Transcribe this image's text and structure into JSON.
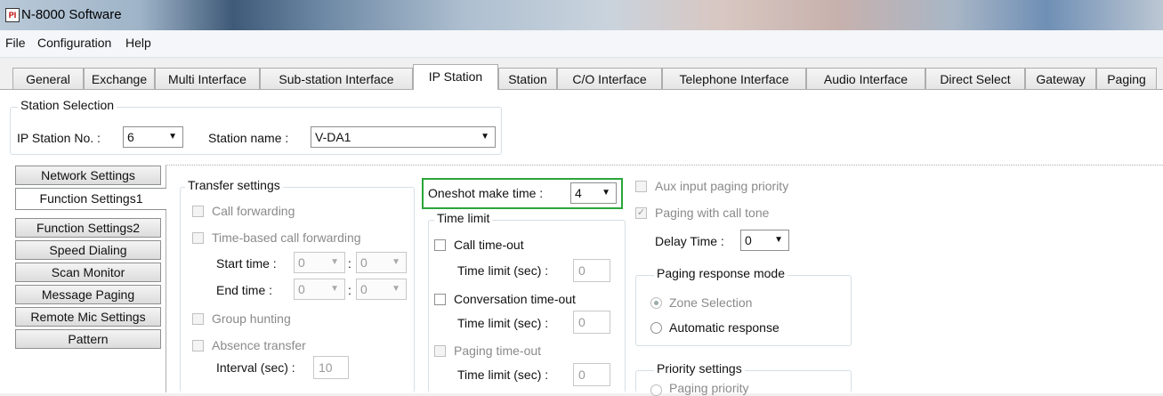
{
  "window": {
    "title": "N-8000 Software",
    "icon_text": "PI"
  },
  "menu": [
    "File",
    "Configuration",
    "Help"
  ],
  "tabs": [
    "General",
    "Exchange",
    "Multi Interface",
    "Sub-station Interface",
    "IP Station",
    "Station",
    "C/O Interface",
    "Telephone Interface",
    "Audio Interface",
    "Direct Select",
    "Gateway",
    "Paging"
  ],
  "active_tab": "IP Station",
  "station_selection": {
    "legend": "Station Selection",
    "ip_no_label": "IP Station No. :",
    "ip_no_value": "6",
    "name_label": "Station name :",
    "name_value": "V-DA1"
  },
  "side_tabs": [
    "Network Settings",
    "Function Settings1",
    "Function Settings2",
    "Speed Dialing",
    "Scan Monitor",
    "Message Paging",
    "Remote Mic Settings",
    "Pattern"
  ],
  "active_side_tab": "Function Settings1",
  "transfer": {
    "legend": "Transfer settings",
    "call_forwarding": "Call forwarding",
    "time_based": "Time-based call forwarding",
    "start_time_label": "Start time :",
    "start_hour": "0",
    "start_min": "0",
    "end_time_label": "End time  :",
    "end_hour": "0",
    "end_min": "0",
    "colon": ":",
    "group_hunting": "Group hunting",
    "absence_transfer": "Absence transfer",
    "interval_label": "Interval (sec) :",
    "interval_value": "10"
  },
  "oneshot": {
    "label": "Oneshot make time :",
    "value": "4",
    "highlight_color": "#2aa63a"
  },
  "time_limit": {
    "legend": "Time limit",
    "call_timeout": "Call time-out",
    "conversation_timeout": "Conversation time-out",
    "paging_timeout": "Paging time-out",
    "limit_label": "Time limit (sec) :",
    "call_value": "0",
    "conversation_value": "0",
    "paging_value": "0"
  },
  "paging": {
    "aux_priority": "Aux input paging priority",
    "with_call_tone": "Paging with call tone",
    "delay_label": "Delay Time :",
    "delay_value": "0",
    "response_legend": "Paging response mode",
    "zone_selection": "Zone Selection",
    "automatic_response": "Automatic response",
    "priority_legend": "Priority settings",
    "paging_priority": "Paging priority"
  }
}
